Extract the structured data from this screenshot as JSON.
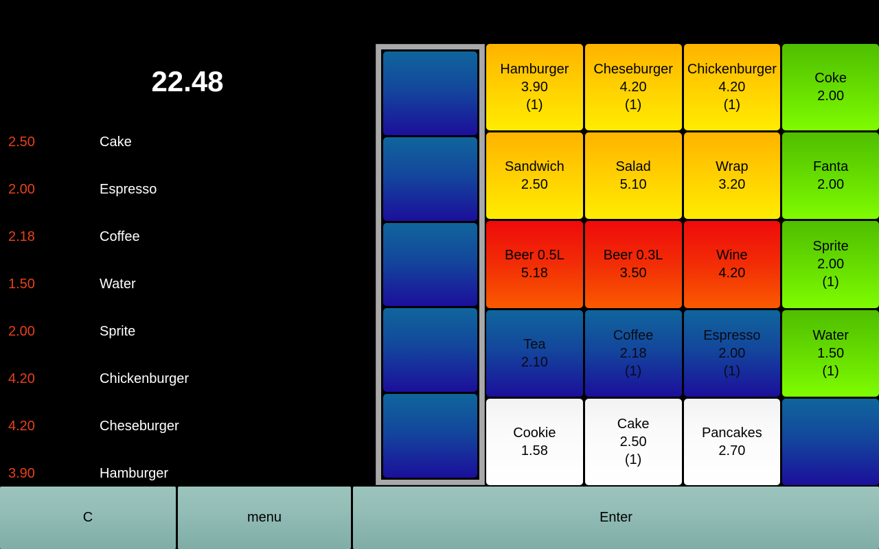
{
  "order": {
    "total": "22.48",
    "items": [
      {
        "price": "2.50",
        "name": "Cake"
      },
      {
        "price": "2.00",
        "name": "Espresso"
      },
      {
        "price": "2.18",
        "name": "Coffee"
      },
      {
        "price": "1.50",
        "name": "Water"
      },
      {
        "price": "2.00",
        "name": "Sprite"
      },
      {
        "price": "4.20",
        "name": "Chickenburger"
      },
      {
        "price": "4.20",
        "name": "Cheseburger"
      },
      {
        "price": "3.90",
        "name": "Hamburger"
      }
    ]
  },
  "categories": [
    {
      "label": ""
    },
    {
      "label": ""
    },
    {
      "label": ""
    },
    {
      "label": ""
    },
    {
      "label": ""
    }
  ],
  "products": [
    {
      "name": "Hamburger",
      "price": "3.90",
      "qty": "(1)",
      "color": "yellow",
      "empty": false
    },
    {
      "name": "Cheseburger",
      "price": "4.20",
      "qty": "(1)",
      "color": "yellow",
      "empty": false
    },
    {
      "name": "Chickenburger",
      "price": "4.20",
      "qty": "(1)",
      "color": "yellow",
      "empty": false
    },
    {
      "name": "Coke",
      "price": "2.00",
      "qty": "",
      "color": "green",
      "empty": false
    },
    {
      "name": "Sandwich",
      "price": "2.50",
      "qty": "",
      "color": "yellow",
      "empty": false
    },
    {
      "name": "Salad",
      "price": "5.10",
      "qty": "",
      "color": "yellow",
      "empty": false
    },
    {
      "name": "Wrap",
      "price": "3.20",
      "qty": "",
      "color": "yellow",
      "empty": false
    },
    {
      "name": "Fanta",
      "price": "2.00",
      "qty": "",
      "color": "green",
      "empty": false
    },
    {
      "name": "Beer 0.5L",
      "price": "5.18",
      "qty": "",
      "color": "red",
      "empty": false
    },
    {
      "name": "Beer 0.3L",
      "price": "3.50",
      "qty": "",
      "color": "red",
      "empty": false
    },
    {
      "name": "Wine",
      "price": "4.20",
      "qty": "",
      "color": "red",
      "empty": false
    },
    {
      "name": "Sprite",
      "price": "2.00",
      "qty": "(1)",
      "color": "green",
      "empty": false
    },
    {
      "name": "Tea",
      "price": "2.10",
      "qty": "",
      "color": "blue",
      "empty": false
    },
    {
      "name": "Coffee",
      "price": "2.18",
      "qty": "(1)",
      "color": "blue",
      "empty": false
    },
    {
      "name": "Espresso",
      "price": "2.00",
      "qty": "(1)",
      "color": "blue",
      "empty": false
    },
    {
      "name": "Water",
      "price": "1.50",
      "qty": "(1)",
      "color": "green",
      "empty": false
    },
    {
      "name": "Cookie",
      "price": "1.58",
      "qty": "",
      "color": "white",
      "empty": false
    },
    {
      "name": "Cake",
      "price": "2.50",
      "qty": "(1)",
      "color": "white",
      "empty": false
    },
    {
      "name": "Pancakes",
      "price": "2.70",
      "qty": "",
      "color": "white",
      "empty": false
    },
    {
      "name": "",
      "price": "",
      "qty": "",
      "color": "blue",
      "empty": true
    }
  ],
  "actions": {
    "clear_label": "C",
    "menu_label": "menu",
    "enter_label": "Enter"
  },
  "colors": {
    "background": "#000000",
    "total_text": "#ffffff",
    "price_text": "#e8401a",
    "item_text": "#ffffff",
    "frame_border": "#a9a9a9",
    "action_bar": "#93bdb6"
  }
}
